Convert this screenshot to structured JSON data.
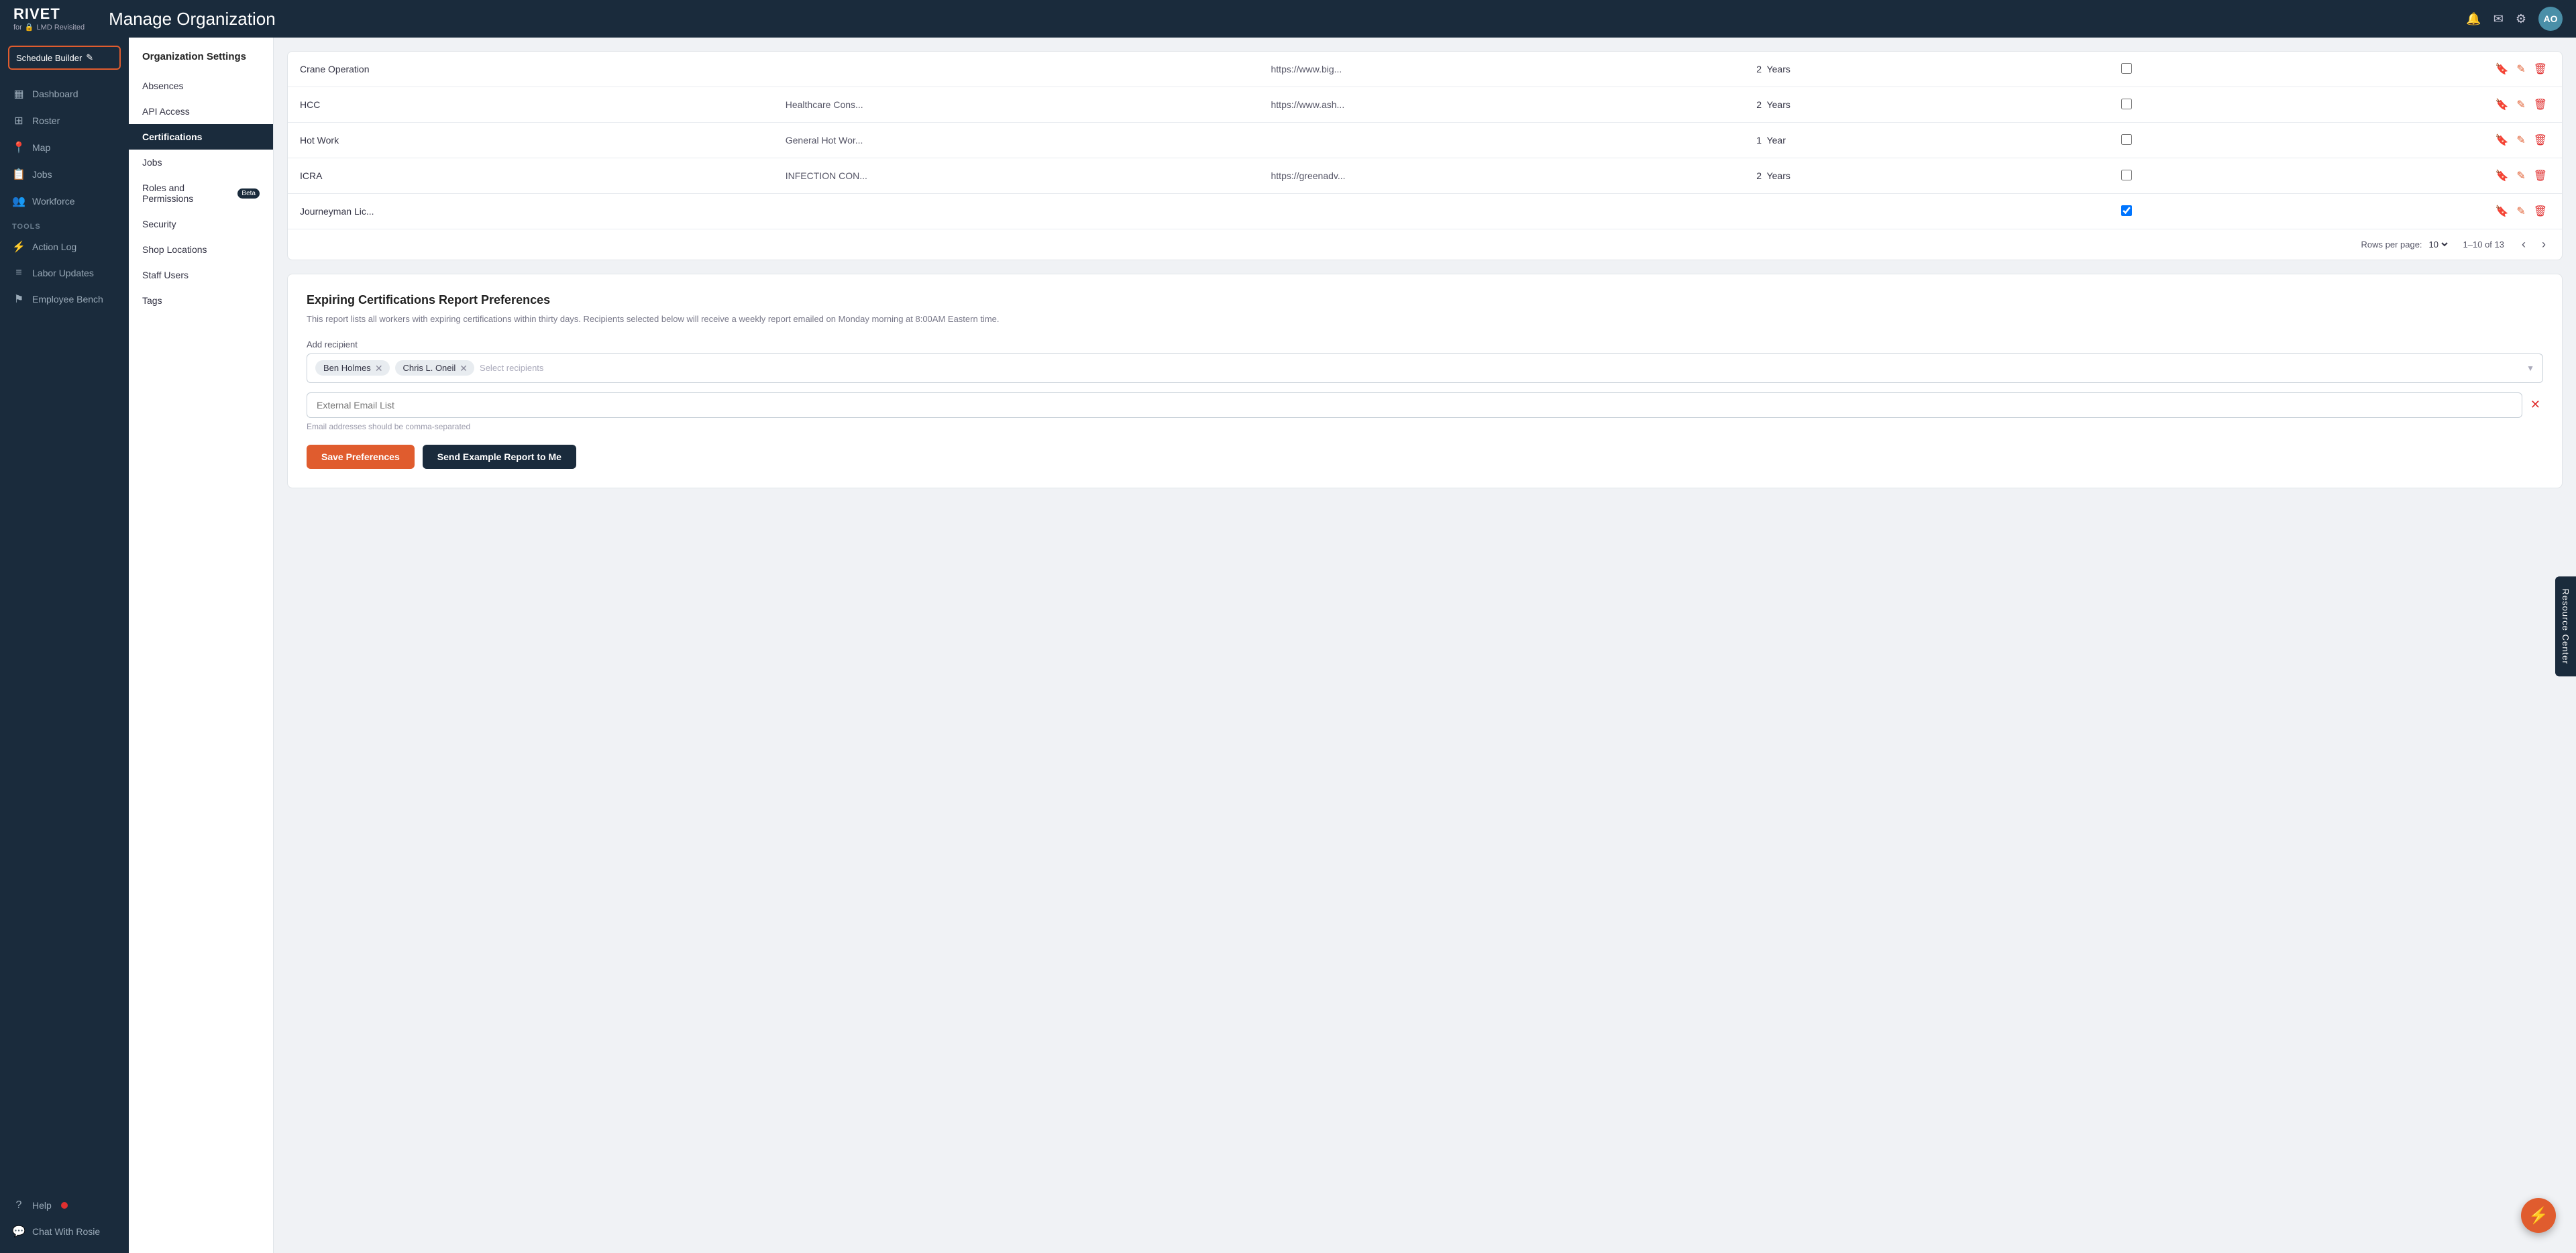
{
  "app": {
    "logo": "RIVET",
    "org_label": "for",
    "lock_icon": "🔒",
    "org_name": "LMD Revisited",
    "page_title": "Manage Organization"
  },
  "topnav": {
    "bell_label": "notifications",
    "mail_label": "messages",
    "gear_label": "settings",
    "avatar_initials": "AO"
  },
  "sidebar": {
    "schedule_btn": "Schedule Builder",
    "nav_items": [
      {
        "id": "dashboard",
        "label": "Dashboard",
        "icon": "▦"
      },
      {
        "id": "roster",
        "label": "Roster",
        "icon": "⊞"
      },
      {
        "id": "map",
        "label": "Map",
        "icon": "📍"
      },
      {
        "id": "jobs",
        "label": "Jobs",
        "icon": "📋"
      },
      {
        "id": "workforce",
        "label": "Workforce",
        "icon": "👥"
      }
    ],
    "tools_label": "TOOLS",
    "tools_items": [
      {
        "id": "action-log",
        "label": "Action Log",
        "icon": "⚡"
      },
      {
        "id": "labor-updates",
        "label": "Labor Updates",
        "icon": "≡"
      },
      {
        "id": "employee-bench",
        "label": "Employee Bench",
        "icon": "⚑"
      }
    ],
    "bottom_items": [
      {
        "id": "help",
        "label": "Help",
        "icon": "?"
      },
      {
        "id": "chat",
        "label": "Chat With Rosie",
        "icon": "💬"
      }
    ]
  },
  "settings_sidebar": {
    "title": "Organization Settings",
    "items": [
      {
        "id": "absences",
        "label": "Absences",
        "active": false
      },
      {
        "id": "api-access",
        "label": "API Access",
        "active": false
      },
      {
        "id": "certifications",
        "label": "Certifications",
        "active": true
      },
      {
        "id": "jobs",
        "label": "Jobs",
        "active": false
      },
      {
        "id": "roles-permissions",
        "label": "Roles and Permissions",
        "active": false,
        "beta": true
      },
      {
        "id": "security",
        "label": "Security",
        "active": false
      },
      {
        "id": "shop-locations",
        "label": "Shop Locations",
        "active": false
      },
      {
        "id": "staff-users",
        "label": "Staff Users",
        "active": false
      },
      {
        "id": "tags",
        "label": "Tags",
        "active": false
      }
    ]
  },
  "cert_table": {
    "rows": [
      {
        "name": "Crane Operation",
        "desc": "",
        "url": "https://www.big...",
        "exp_count": "2",
        "exp_unit": "Years",
        "required": false
      },
      {
        "name": "HCC",
        "desc": "Healthcare Cons...",
        "url": "https://www.ash...",
        "exp_count": "2",
        "exp_unit": "Years",
        "required": false
      },
      {
        "name": "Hot Work",
        "desc": "General Hot Wor...",
        "url": "",
        "exp_count": "1",
        "exp_unit": "Year",
        "required": false
      },
      {
        "name": "ICRA",
        "desc": "INFECTION CON...",
        "url": "https://greenadv...",
        "exp_count": "2",
        "exp_unit": "Years",
        "required": false
      },
      {
        "name": "Journeyman Lic...",
        "desc": "",
        "url": "",
        "exp_count": "",
        "exp_unit": "",
        "required": true
      }
    ],
    "pagination": {
      "rows_per_page_label": "Rows per page:",
      "rows_per_page_value": "10",
      "page_info": "1–10 of 13"
    }
  },
  "report_prefs": {
    "title": "Expiring Certifications Report Preferences",
    "description": "This report lists all workers with expiring certifications within thirty days. Recipients selected below will receive a weekly report emailed on Monday morning at 8:00AM Eastern time.",
    "add_recipient_label": "Add recipient",
    "recipients": [
      {
        "name": "Ben Holmes"
      },
      {
        "name": "Chris L. Oneil"
      }
    ],
    "select_placeholder": "Select recipients",
    "external_email_placeholder": "External Email List",
    "email_hint": "Email addresses should be comma-separated",
    "save_btn": "Save Preferences",
    "send_btn": "Send Example Report to Me"
  },
  "resource_center": {
    "label": "Resource Center"
  },
  "floating_btn": {
    "icon": "⚡"
  }
}
